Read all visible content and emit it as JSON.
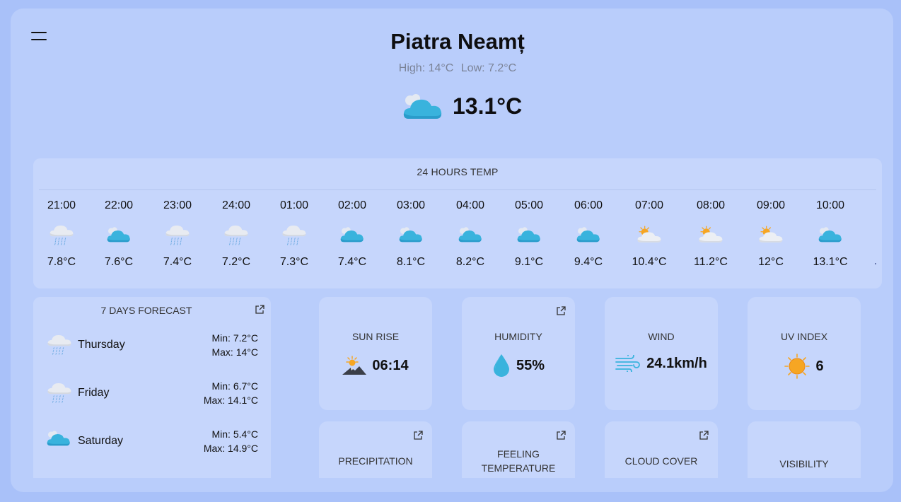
{
  "header": {
    "city": "Piatra Neamț",
    "high": "High: 14°C",
    "low": "Low: 7.2°C",
    "current_temp": "13.1°C",
    "current_icon": "cloud-icon"
  },
  "hourly": {
    "title": "24 HOURS TEMP",
    "items": [
      {
        "time": "21:00",
        "temp": "7.8°C",
        "icon": "rain-cloud-icon"
      },
      {
        "time": "22:00",
        "temp": "7.6°C",
        "icon": "cloud-icon"
      },
      {
        "time": "23:00",
        "temp": "7.4°C",
        "icon": "rain-cloud-icon"
      },
      {
        "time": "24:00",
        "temp": "7.2°C",
        "icon": "rain-cloud-icon"
      },
      {
        "time": "01:00",
        "temp": "7.3°C",
        "icon": "rain-cloud-icon"
      },
      {
        "time": "02:00",
        "temp": "7.4°C",
        "icon": "cloud-icon"
      },
      {
        "time": "03:00",
        "temp": "8.1°C",
        "icon": "cloud-icon"
      },
      {
        "time": "04:00",
        "temp": "8.2°C",
        "icon": "cloud-icon"
      },
      {
        "time": "05:00",
        "temp": "9.1°C",
        "icon": "cloud-icon"
      },
      {
        "time": "06:00",
        "temp": "9.4°C",
        "icon": "cloud-icon"
      },
      {
        "time": "07:00",
        "temp": "10.4°C",
        "icon": "partly-sunny-icon"
      },
      {
        "time": "08:00",
        "temp": "11.2°C",
        "icon": "partly-sunny-icon"
      },
      {
        "time": "09:00",
        "temp": "12°C",
        "icon": "partly-sunny-icon"
      },
      {
        "time": "10:00",
        "temp": "13.1°C",
        "icon": "cloud-icon"
      }
    ]
  },
  "forecast": {
    "title": "7 DAYS FORECAST",
    "days": [
      {
        "day": "Thursday",
        "min": "Min: 7.2°C",
        "max": "Max: 14°C",
        "icon": "rain-cloud-icon"
      },
      {
        "day": "Friday",
        "min": "Min: 6.7°C",
        "max": "Max: 14.1°C",
        "icon": "rain-cloud-icon"
      },
      {
        "day": "Saturday",
        "min": "Min: 5.4°C",
        "max": "Max: 14.9°C",
        "icon": "cloud-icon"
      }
    ]
  },
  "cards": {
    "sunrise": {
      "label": "SUN RISE",
      "value": "06:14",
      "icon": "sunrise-icon"
    },
    "humidity": {
      "label": "HUMIDITY",
      "value": "55%",
      "icon": "droplet-icon"
    },
    "wind": {
      "label": "WIND",
      "value": "24.1km/h",
      "icon": "wind-icon"
    },
    "uv": {
      "label": "UV INDEX",
      "value": "6",
      "icon": "sun-icon"
    },
    "precipitation": {
      "label": "PRECIPITATION"
    },
    "feeling": {
      "label1": "FEELING",
      "label2": "TEMPERATURE"
    },
    "cloud_cover": {
      "label": "CLOUD COVER"
    },
    "visibility": {
      "label": "VISIBILITY"
    }
  },
  "colors": {
    "background": "#a9c1f9",
    "panel": "#c6d6fc",
    "cloud_blue": "#39b3dd",
    "sun_orange": "#f6a623"
  }
}
